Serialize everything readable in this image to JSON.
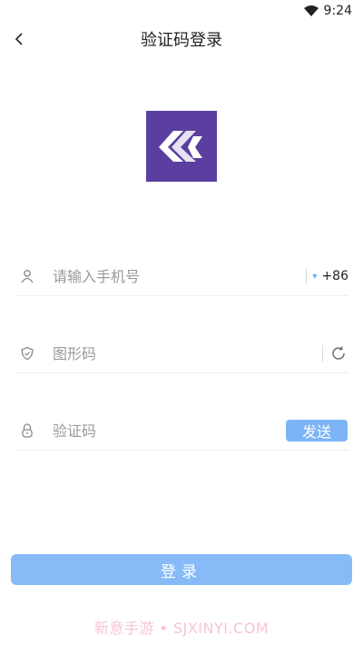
{
  "status_bar": {
    "time": "9:24",
    "icons": [
      "wifi-icon"
    ]
  },
  "nav": {
    "title": "验证码登录",
    "back_icon": "chevron-left-icon"
  },
  "logo": {
    "description_icon": "app-logo",
    "color": "#5b3fa0"
  },
  "form": {
    "phone": {
      "placeholder": "请输入手机号",
      "value": "",
      "country_code": "+86",
      "icon": "user-icon"
    },
    "captcha": {
      "placeholder": "图形码",
      "value": "",
      "icon": "shield-icon",
      "refresh_icon": "refresh-icon"
    },
    "sms_code": {
      "placeholder": "验证码",
      "value": "",
      "icon": "lock-icon",
      "send_label": "发送"
    }
  },
  "login_button": {
    "label": "登录"
  },
  "watermark": {
    "text": "新意手游 • SJXINYI.COM"
  },
  "colors": {
    "accent": "#86bbf8",
    "send": "#7db4f5",
    "logo": "#5b3fa0",
    "watermark": "#f6c5d3"
  }
}
